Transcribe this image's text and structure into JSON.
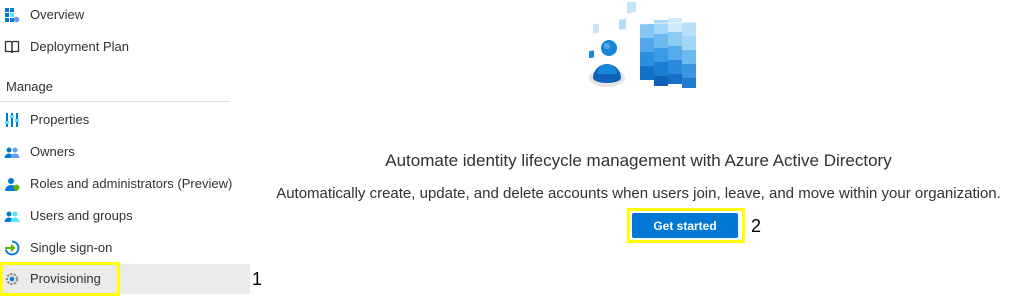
{
  "sidebar": {
    "items": [
      {
        "label": "Overview",
        "icon": "overview-grid-icon"
      },
      {
        "label": "Deployment Plan",
        "icon": "book-icon"
      }
    ],
    "section_header": "Manage",
    "manage_items": [
      {
        "label": "Properties",
        "icon": "properties-sliders-icon"
      },
      {
        "label": "Owners",
        "icon": "owners-people-icon"
      },
      {
        "label": "Roles and administrators (Preview)",
        "icon": "roles-person-icon"
      },
      {
        "label": "Users and groups",
        "icon": "users-groups-icon"
      },
      {
        "label": "Single sign-on",
        "icon": "sso-arrow-icon"
      },
      {
        "label": "Provisioning",
        "icon": "provisioning-gear-icon"
      }
    ],
    "selected": "Provisioning"
  },
  "main": {
    "title": "Automate identity lifecycle management with Azure Active Directory",
    "description": "Automatically create, update, and delete accounts when users join, leave, and move within your organization.",
    "cta_label": "Get started",
    "hero_icon": "identity-provisioning-illustration"
  },
  "annotations": {
    "step1": "1",
    "step2": "2",
    "highlight_color": "#ffff00"
  },
  "colors": {
    "accent": "#0078d4",
    "selected_bg": "#edebe9"
  }
}
